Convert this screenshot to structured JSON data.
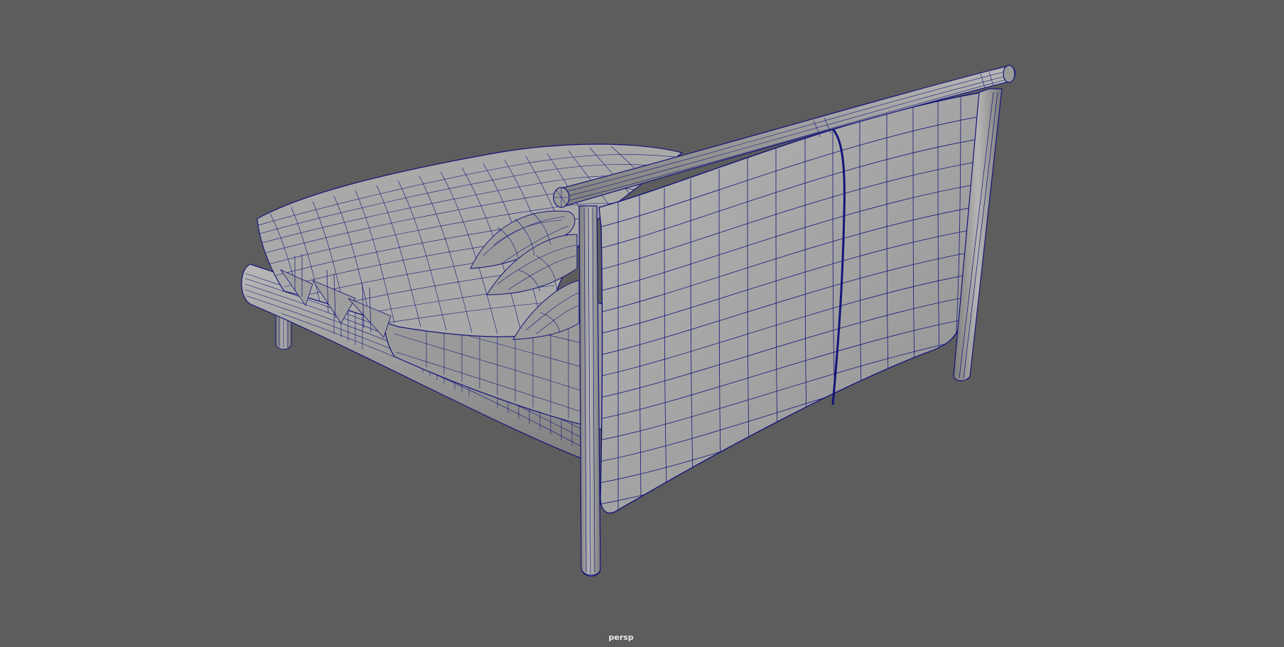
{
  "viewport": {
    "camera_label": "persp",
    "background_color": "#5d5d5d",
    "wireframe_color": "#15157a",
    "surface_color": "#a6a6a6"
  },
  "scene": {
    "object": "bed",
    "display_mode": "wireframe-on-shaded"
  }
}
